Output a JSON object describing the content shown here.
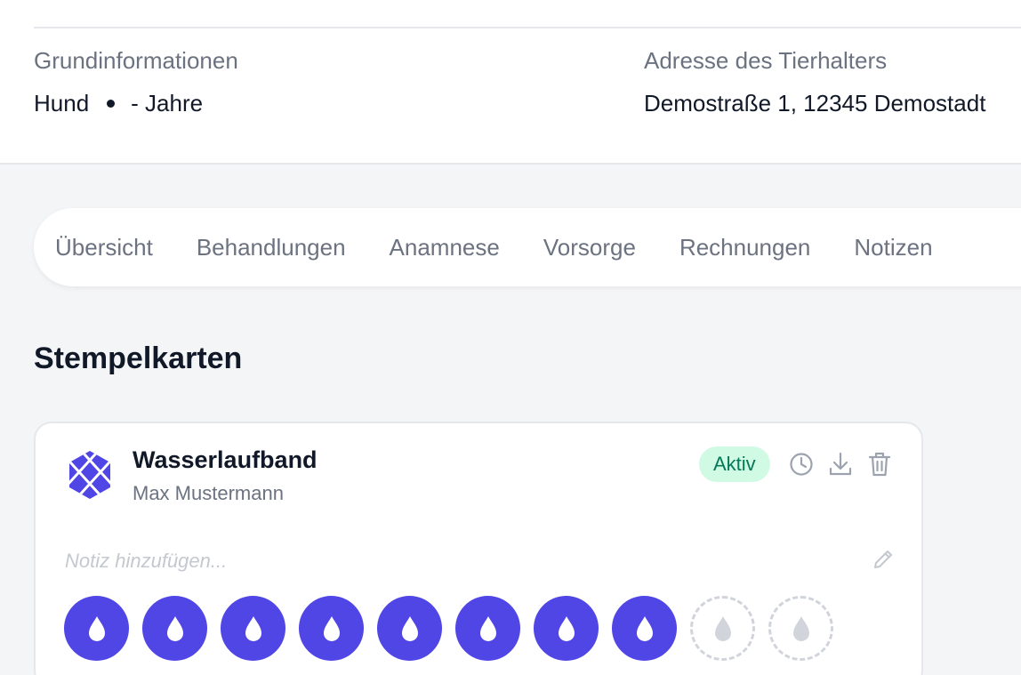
{
  "basic_info": {
    "label": "Grundinformationen",
    "species": "Hund",
    "age": "- Jahre"
  },
  "owner_address": {
    "label": "Adresse des Tierhalters",
    "value": "Demostraße 1, 12345 Demostadt"
  },
  "tabs": [
    {
      "label": "Übersicht"
    },
    {
      "label": "Behandlungen"
    },
    {
      "label": "Anamnese"
    },
    {
      "label": "Vorsorge"
    },
    {
      "label": "Rechnungen"
    },
    {
      "label": "Notizen"
    }
  ],
  "section_title": "Stempelkarten",
  "card": {
    "title": "Wasserlaufband",
    "subtitle": "Max Mustermann",
    "status": "Aktiv",
    "note_placeholder": "Notiz hinzufügen...",
    "icons": [
      "hexagon-logo-icon",
      "history-clock-icon",
      "download-icon",
      "trash-icon",
      "pencil-icon",
      "water-drop-icon"
    ],
    "stamps_filled": 8,
    "stamps_visible": 10
  },
  "colors": {
    "accent": "#4f46e5",
    "badge_bg": "#d1fae5",
    "badge_text": "#047857",
    "empty_stamp": "#d1d5db"
  }
}
